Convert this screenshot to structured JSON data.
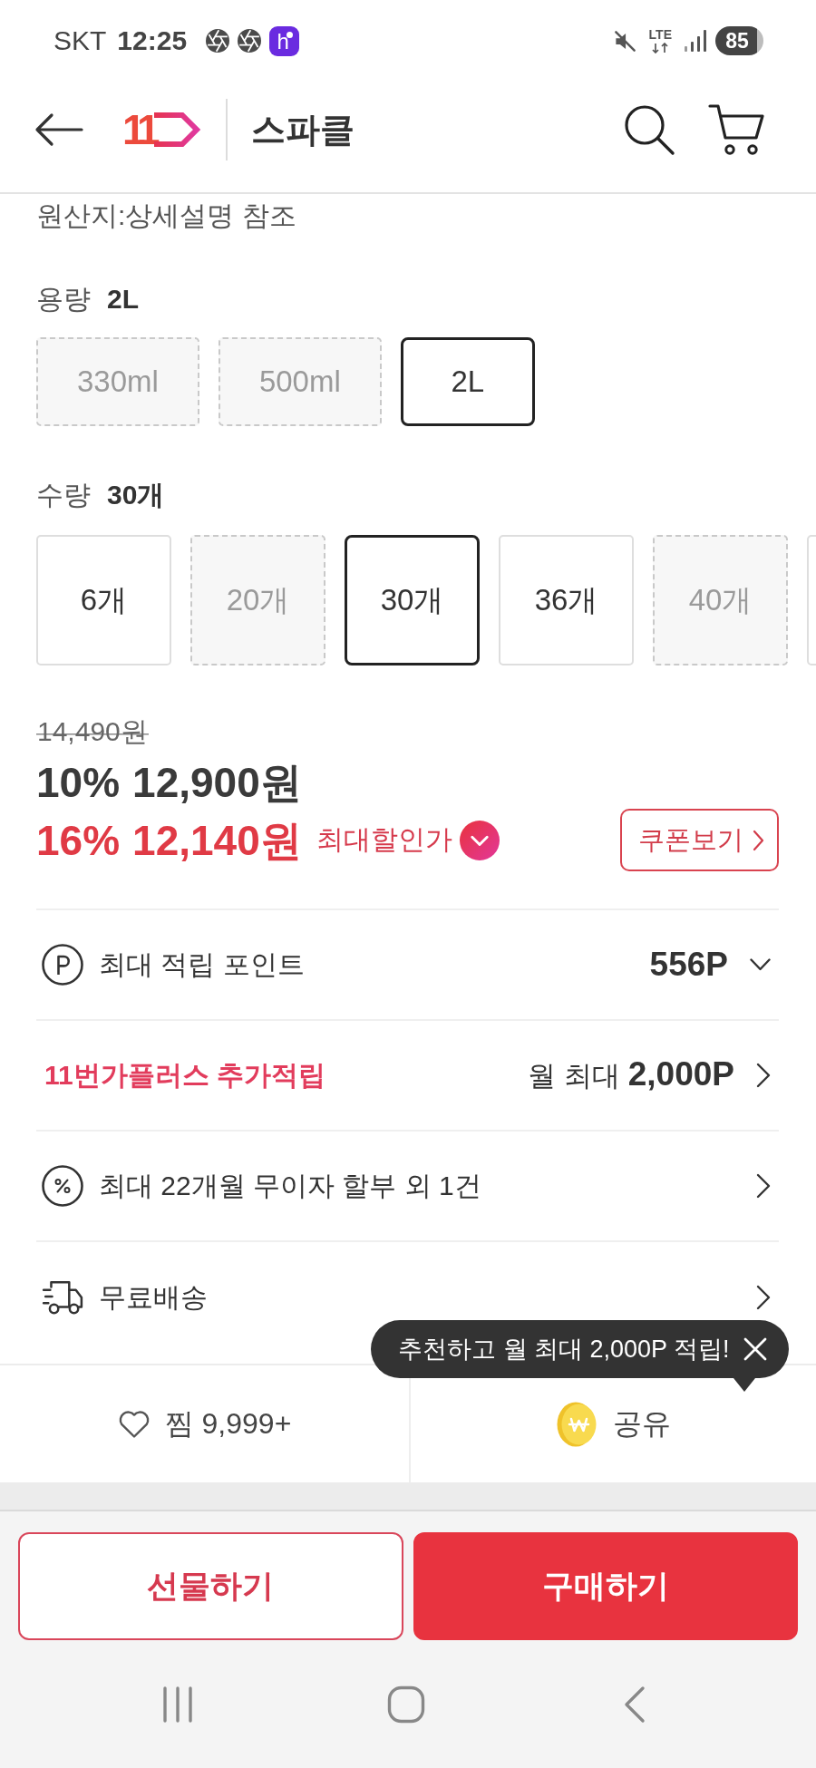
{
  "status_bar": {
    "carrier": "SKT",
    "time": "12:25",
    "notification_badge": "h",
    "network": "LTE",
    "battery": "85"
  },
  "header": {
    "logo": "11",
    "title": "스파클"
  },
  "origin": "원산지:상세설명 참조",
  "volume": {
    "label": "용량",
    "value": "2L",
    "options": [
      {
        "label": "330ml",
        "selected": false,
        "disabled": true
      },
      {
        "label": "500ml",
        "selected": false,
        "disabled": true
      },
      {
        "label": "2L",
        "selected": true,
        "disabled": false
      }
    ]
  },
  "quantity": {
    "label": "수량",
    "value": "30개",
    "options": [
      {
        "label": "6개",
        "selected": false,
        "disabled": false
      },
      {
        "label": "20개",
        "selected": false,
        "disabled": true
      },
      {
        "label": "30개",
        "selected": true,
        "disabled": false
      },
      {
        "label": "36개",
        "selected": false,
        "disabled": false
      },
      {
        "label": "40개",
        "selected": false,
        "disabled": true
      },
      {
        "selected": false,
        "disabled": false
      }
    ]
  },
  "price": {
    "original": "14,490원",
    "sale_rate": "10%",
    "sale_price": "12,900원",
    "max_rate": "16%",
    "max_price": "12,140원",
    "max_label": "최대할인가",
    "coupon_button": "쿠폰보기"
  },
  "benefits": [
    {
      "kind": "points",
      "label": "최대 적립 포인트",
      "value": "556P"
    },
    {
      "kind": "membership",
      "label": "11번가플러스 추가적립",
      "value": "월 최대 **2,000P**"
    },
    {
      "kind": "installment",
      "label": "최대 22개월 무이자 할부 외 1건"
    },
    {
      "kind": "shipping",
      "label": "무료배송"
    }
  ],
  "tooltip": {
    "text": "추천하고 월 최대 2,000P 적립!"
  },
  "actions": {
    "wishlist": "찜 9,999+",
    "share": "공유"
  },
  "buttons": [
    {
      "kind": "outline",
      "label": "선물하기"
    },
    {
      "kind": "filled",
      "label": "구매하기"
    }
  ]
}
